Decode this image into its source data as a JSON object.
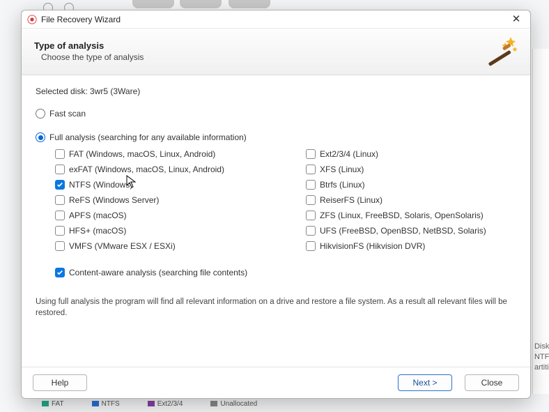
{
  "window": {
    "title": "File Recovery Wizard"
  },
  "header": {
    "heading": "Type of analysis",
    "subtitle": "Choose the type of analysis"
  },
  "body": {
    "selected_disk_label": "Selected disk: 3wr5 (3Ware)",
    "fast_scan_label": "Fast scan",
    "full_analysis_label": "Full analysis (searching for any available information)",
    "content_aware_label": "Content-aware analysis (searching file contents)",
    "description": "Using full analysis the program will find all relevant information on a drive and restore a file system. As a result all relevant files will be restored."
  },
  "filesystems": {
    "left": [
      {
        "key": "fat",
        "label": "FAT (Windows, macOS, Linux, Android)",
        "checked": false
      },
      {
        "key": "exfat",
        "label": "exFAT (Windows, macOS, Linux, Android)",
        "checked": false
      },
      {
        "key": "ntfs",
        "label": "NTFS (Windows)",
        "checked": true
      },
      {
        "key": "refs",
        "label": "ReFS (Windows Server)",
        "checked": false
      },
      {
        "key": "apfs",
        "label": "APFS (macOS)",
        "checked": false
      },
      {
        "key": "hfsplus",
        "label": "HFS+ (macOS)",
        "checked": false
      },
      {
        "key": "vmfs",
        "label": "VMFS (VMware ESX / ESXi)",
        "checked": false
      }
    ],
    "right": [
      {
        "key": "ext",
        "label": "Ext2/3/4 (Linux)",
        "checked": false
      },
      {
        "key": "xfs",
        "label": "XFS (Linux)",
        "checked": false
      },
      {
        "key": "btrfs",
        "label": "Btrfs (Linux)",
        "checked": false
      },
      {
        "key": "reiserfs",
        "label": "ReiserFS (Linux)",
        "checked": false
      },
      {
        "key": "zfs",
        "label": "ZFS (Linux, FreeBSD, Solaris, OpenSolaris)",
        "checked": false
      },
      {
        "key": "ufs",
        "label": "UFS (FreeBSD, OpenBSD, NetBSD, Solaris)",
        "checked": false
      },
      {
        "key": "hikvisionfs",
        "label": "HikvisionFS (Hikvision DVR)",
        "checked": false
      }
    ]
  },
  "footer": {
    "help": "Help",
    "next": "Next >",
    "close": "Close"
  },
  "backdrop": {
    "right_labels": [
      "Disk",
      "NTFS",
      "artition"
    ],
    "legend": [
      "FAT",
      "NTFS",
      "Ext2/3/4",
      "Unallocated"
    ]
  }
}
